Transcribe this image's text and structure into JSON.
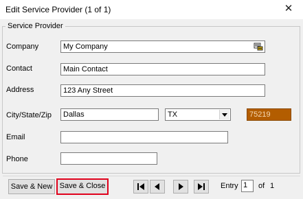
{
  "window": {
    "title": "Edit Service Provider (1 of 1)",
    "close_glyph": "✕"
  },
  "group": {
    "label": "Service Provider"
  },
  "fields": {
    "company": {
      "label": "Company",
      "value": "My Company",
      "icon": "lookup-icon"
    },
    "contact": {
      "label": "Contact",
      "value": "Main Contact"
    },
    "address": {
      "label": "Address",
      "value": "123 Any Street"
    },
    "city_state_zip": {
      "label": "City/State/Zip",
      "city": "Dallas",
      "state": "TX",
      "zip": "75219"
    },
    "email": {
      "label": "Email",
      "value": ""
    },
    "phone": {
      "label": "Phone",
      "value": ""
    }
  },
  "footer": {
    "save_new_label": "Save & New",
    "save_close_label": "Save & Close",
    "entry_label": "Entry",
    "entry_value": "1",
    "of_label": "of",
    "total": "1"
  },
  "colors": {
    "zip_bg": "#b35d00",
    "zip_text": "#f6d9b6",
    "highlight": "#e0001b"
  }
}
